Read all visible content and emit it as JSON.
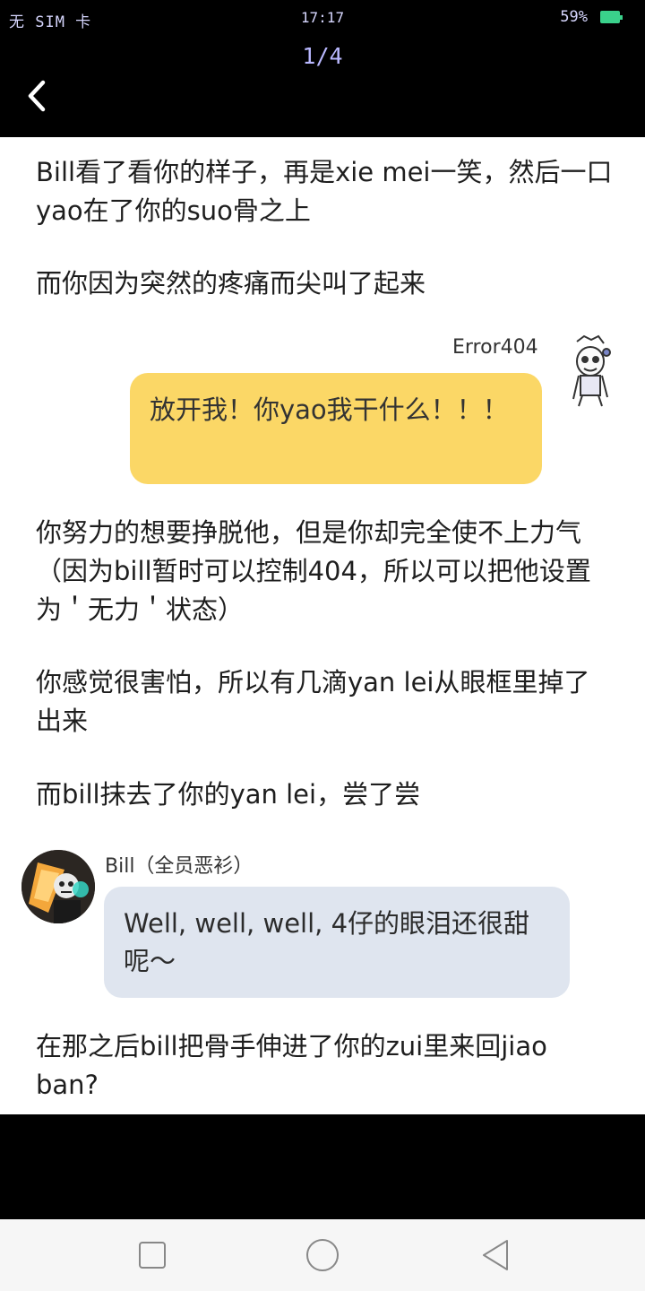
{
  "status_bar": {
    "carrier": "无 SIM 卡",
    "time": "17:17",
    "battery": "59%"
  },
  "viewer": {
    "page_indicator": "1/4"
  },
  "story": {
    "p1": "Bill看了看你的样子，再是xie mei一笑，然后一口yao在了你的suo骨之上",
    "p2": "而你因为突然的疼痛而尖叫了起来",
    "error_name": "Error404",
    "error_line": "放开我！你yao我干什么！！！",
    "p3": "你努力的想要挣脱他，但是你却完全使不上力气（因为bill暂时可以控制404，所以可以把他设置为＇无力＇状态）",
    "p4": "你感觉很害怕，所以有几滴yan lei从眼框里掉了出来",
    "p5": "而bill抹去了你的yan lei，尝了尝",
    "bill_name": "Bill（全员恶衫）",
    "bill_line": "Well, well, well, 4仔的眼泪还很甜呢～",
    "p6": "在那之后bill把骨手伸进了你的zui里来回jiao ban?"
  },
  "colors": {
    "error_bubble": "#fbd766",
    "bill_bubble": "#dfe5ef",
    "battery": "#3ad18b"
  },
  "icons": {
    "back": "chevron-left-icon",
    "nav_recent": "square-icon",
    "nav_home": "circle-icon",
    "nav_back": "triangle-back-icon"
  }
}
